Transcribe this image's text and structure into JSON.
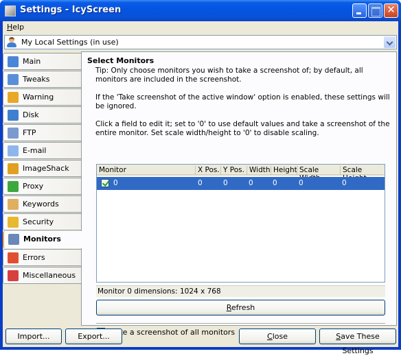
{
  "window": {
    "title": "Settings - IcyScreen"
  },
  "menubar": {
    "items": [
      {
        "label": "Help",
        "accel": "H",
        "rest": "elp"
      }
    ]
  },
  "profile": {
    "selected": "My Local Settings (in use)",
    "icon": "user-icon"
  },
  "sidebar": {
    "items": [
      {
        "label": "Main",
        "icon": "grid-icon",
        "color": "#4a86d8",
        "active": false
      },
      {
        "label": "Tweaks",
        "icon": "wrench-icon",
        "color": "#5a8fd8",
        "active": false
      },
      {
        "label": "Warning",
        "icon": "bell-icon",
        "color": "#e8a828",
        "active": false
      },
      {
        "label": "Disk",
        "icon": "floppy-disk-icon",
        "color": "#3e7fd0",
        "active": false
      },
      {
        "label": "FTP",
        "icon": "ftp-server-icon",
        "color": "#7a9ad0",
        "active": false
      },
      {
        "label": "E-mail",
        "icon": "envelope-icon",
        "color": "#8fb6ec",
        "active": false
      },
      {
        "label": "ImageShack",
        "icon": "imageshack-frog-icon",
        "color": "#e0a020",
        "active": false
      },
      {
        "label": "Proxy",
        "icon": "proxy-icon",
        "color": "#3da83d",
        "active": false
      },
      {
        "label": "Keywords",
        "icon": "magnifier-icon",
        "color": "#e0b060",
        "active": false
      },
      {
        "label": "Security",
        "icon": "padlock-icon",
        "color": "#e8b830",
        "active": false
      },
      {
        "label": "Monitors",
        "icon": "monitor-icon",
        "color": "#6a88b8",
        "active": true
      },
      {
        "label": "Errors",
        "icon": "error-icon",
        "color": "#e05030",
        "active": false
      },
      {
        "label": "Miscellaneous",
        "icon": "cubes-icon",
        "color": "#d84040",
        "active": false
      }
    ]
  },
  "panel": {
    "title": "Select Monitors",
    "tip": "Tip: Only choose monitors you wish to take a screenshot of; by default, all monitors are included in the screenshot.",
    "note": "If the 'Take screenshot of the active window' option is enabled, these settings will be ignored.",
    "instructions": "Click a field to edit it; set to '0' to use default values and take a screenshot of the entire monitor. Set scale width/height to '0' to disable scaling.",
    "table": {
      "columns": [
        "Monitor",
        "X Pos.",
        "Y Pos.",
        "Width",
        "Height",
        "Scale Width",
        "Scale Height"
      ],
      "rows": [
        {
          "checked": true,
          "monitor": "0",
          "x": "0",
          "y": "0",
          "width": "0",
          "height": "0",
          "scale_width": "0",
          "scale_height": "0",
          "selected": true
        }
      ]
    },
    "dimensions": "Monitor 0 dimensions: 1024 x 768",
    "refresh": {
      "accel": "R",
      "rest": "efresh"
    },
    "all_monitors": {
      "checked": true,
      "accel": "T",
      "rest": "ake a screenshot of all monitors"
    }
  },
  "footer": {
    "import": "Import...",
    "export": "Export...",
    "close": {
      "accel": "C",
      "rest": "lose"
    },
    "save": {
      "accel": "S",
      "rest": "ave These Settings"
    }
  },
  "colors": {
    "selection": "#316ac5",
    "titlebar": "#0454e2",
    "active_tab_accent": "#f7a733"
  }
}
